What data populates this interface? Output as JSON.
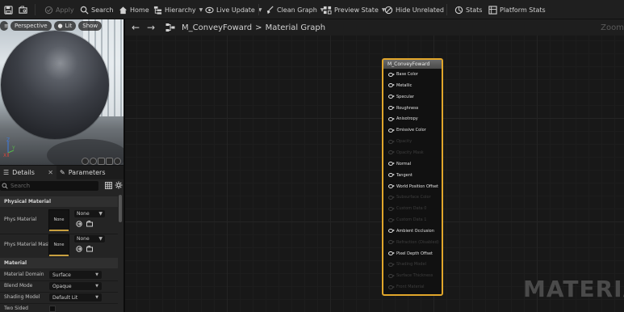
{
  "toolbar": {
    "save_icon": "save-icon",
    "browse_icon": "browse-icon",
    "apply": "Apply",
    "search": "Search",
    "home": "Home",
    "hierarchy": "Hierarchy",
    "live_update": "Live Update",
    "clean_graph": "Clean Graph",
    "preview_state": "Preview State",
    "hide_unrelated": "Hide Unrelated",
    "stats": "Stats",
    "platform_stats": "Platform Stats"
  },
  "viewport": {
    "perspective": "Perspective",
    "lit": "Lit",
    "show": "Show",
    "axis_z": "Z",
    "axis_y": "Y",
    "axis_x": "X"
  },
  "details": {
    "tab_details": "Details",
    "tab_parameters": "Parameters",
    "search_placeholder": "Search",
    "physical_material_header": "Physical Material",
    "phys_material_label": "Phys Material",
    "phys_material_thumb": "None",
    "phys_material_value": "None",
    "phys_material_mask_label": "Phys Material Mask",
    "phys_material_mask_thumb": "None",
    "phys_material_mask_value": "None",
    "material_header": "Material",
    "material_domain_label": "Material Domain",
    "material_domain_value": "Surface",
    "blend_mode_label": "Blend Mode",
    "blend_mode_value": "Opaque",
    "shading_model_label": "Shading Model",
    "shading_model_value": "Default Lit",
    "two_sided_label": "Two Sided"
  },
  "graph": {
    "asset_name": "M_ConveyFoward",
    "separator": ">",
    "graph_name": "Material Graph",
    "zoom": "Zoom",
    "watermark": "MATERIA"
  },
  "node": {
    "title": "M_ConveyFoward",
    "pins": [
      {
        "label": "Base Color",
        "enabled": true
      },
      {
        "label": "Metallic",
        "enabled": true
      },
      {
        "label": "Specular",
        "enabled": true
      },
      {
        "label": "Roughness",
        "enabled": true
      },
      {
        "label": "Anisotropy",
        "enabled": true
      },
      {
        "label": "Emissive Color",
        "enabled": true
      },
      {
        "label": "Opacity",
        "enabled": false
      },
      {
        "label": "Opacity Mask",
        "enabled": false
      },
      {
        "label": "Normal",
        "enabled": true
      },
      {
        "label": "Tangent",
        "enabled": true
      },
      {
        "label": "World Position Offset",
        "enabled": true
      },
      {
        "label": "Subsurface Color",
        "enabled": false
      },
      {
        "label": "Custom Data 0",
        "enabled": false
      },
      {
        "label": "Custom Data 1",
        "enabled": false
      },
      {
        "label": "Ambient Occlusion",
        "enabled": true
      },
      {
        "label": "Refraction (Disabled)",
        "enabled": false
      },
      {
        "label": "Pixel Depth Offset",
        "enabled": true
      },
      {
        "label": "Shading Model",
        "enabled": false
      },
      {
        "label": "Surface Thickness",
        "enabled": false
      },
      {
        "label": "Front Material",
        "enabled": false
      }
    ]
  },
  "colors": {
    "node_border": "#e1a62b",
    "background": "#151515"
  }
}
